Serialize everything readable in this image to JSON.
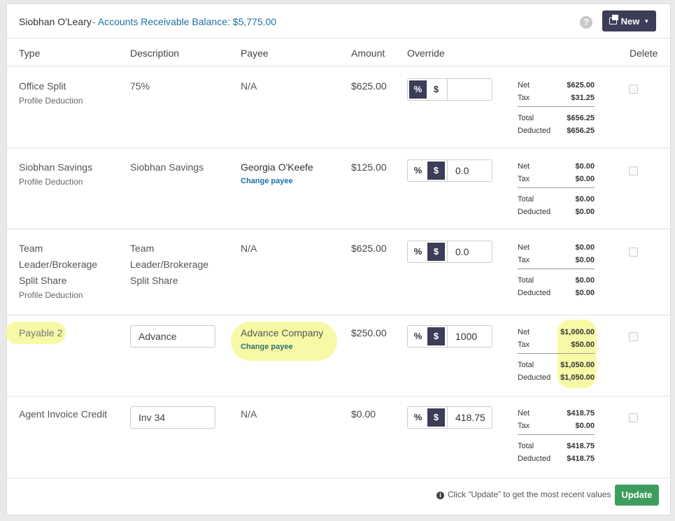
{
  "header": {
    "agent_name": "Siobhan O'Leary",
    "ar_balance": "- Accounts Receivable Balance: $5,775.00",
    "help_icon": "question-circle-icon",
    "new_label": "New",
    "new_icon": "copy-icon"
  },
  "columns": {
    "type": "Type",
    "description": "Description",
    "payee": "Payee",
    "amount": "Amount",
    "override": "Override",
    "delete": "Delete"
  },
  "rows": [
    {
      "type": "Office Split",
      "type_sub": "Profile Deduction",
      "description": "75%",
      "payee": "N/A",
      "amount": "$625.00",
      "override_mode": "%",
      "override_value": "",
      "summary": {
        "net_label": "Net",
        "net": "$625.00",
        "tax_label": "Tax",
        "tax": "$31.25",
        "total_label": "Total",
        "total": "$656.25",
        "deducted_label": "Deducted",
        "deducted": "$656.25"
      }
    },
    {
      "type": "Siobhan Savings",
      "type_sub": "Profile Deduction",
      "description": "Siobhan Savings",
      "payee": "Georgia O'Keefe",
      "change_payee": "Change payee",
      "amount": "$125.00",
      "override_mode": "$",
      "override_value": "0.0",
      "summary": {
        "net_label": "Net",
        "net": "$0.00",
        "tax_label": "Tax",
        "tax": "$0.00",
        "total_label": "Total",
        "total": "$0.00",
        "deducted_label": "Deducted",
        "deducted": "$0.00"
      }
    },
    {
      "type_lines": [
        "Team",
        "Leader/Brokerage",
        "Split Share"
      ],
      "type_sub": "Profile Deduction",
      "description_lines": [
        "Team",
        "Leader/Brokerage",
        "Split Share"
      ],
      "payee": "N/A",
      "amount": "$625.00",
      "override_mode": "$",
      "override_value": "0.0",
      "summary": {
        "net_label": "Net",
        "net": "$0.00",
        "tax_label": "Tax",
        "tax": "$0.00",
        "total_label": "Total",
        "total": "$0.00",
        "deducted_label": "Deducted",
        "deducted": "$0.00"
      }
    },
    {
      "type": "Payable 2",
      "description": "Advance",
      "payee": "Advance Company",
      "change_payee": "Change payee",
      "amount": "$250.00",
      "override_mode": "$",
      "override_value": "1000",
      "summary": {
        "net_label": "Net",
        "net": "$1,000.00",
        "tax_label": "Tax",
        "tax": "$50.00",
        "total_label": "Total",
        "total": "$1,050.00",
        "deducted_label": "Deducted",
        "deducted": "$1,050.00"
      }
    },
    {
      "type": "Agent Invoice Credit",
      "description": "Inv 34",
      "payee": "N/A",
      "amount": "$0.00",
      "override_mode": "$",
      "override_value": "418.75",
      "summary": {
        "net_label": "Net",
        "net": "$418.75",
        "tax_label": "Tax",
        "tax": "$0.00",
        "total_label": "Total",
        "total": "$418.75",
        "deducted_label": "Deducted",
        "deducted": "$418.75"
      }
    }
  ],
  "footer": {
    "info_icon": "info-circle-icon",
    "note": "Click “Update” to get the most recent values",
    "update_label": "Update"
  },
  "highlight_color": "#f6f78a"
}
